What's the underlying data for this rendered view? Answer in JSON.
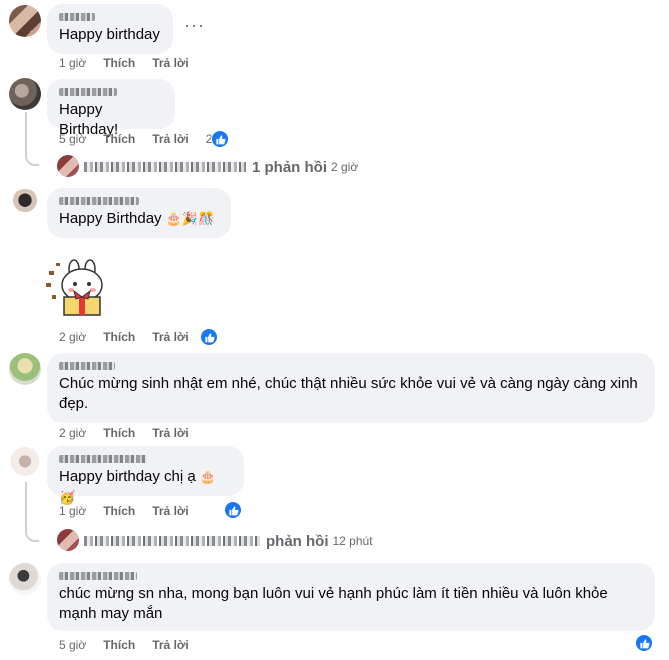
{
  "comments": [
    {
      "text": "Happy birthday",
      "time": "1 giờ",
      "like": "Thích",
      "reply": "Trả lời"
    },
    {
      "text": "Happy Birthday!",
      "time": "5 giờ",
      "like": "Thích",
      "reply": "Trả lời",
      "reactions": "2",
      "replies_summary": {
        "count": "1 phản hồi",
        "time": "2 giờ"
      }
    },
    {
      "text": "Happy Birthday",
      "time": "2 giờ",
      "like": "Thích",
      "reply": "Trả lời",
      "has_sticker": true
    },
    {
      "text_line1": "Chúc mừng sinh nhật em nhé, chúc thật nhiều sức khỏe vui vẻ và càng ngày càng xinh",
      "text_line2": "đẹp.",
      "time": "2 giờ",
      "like": "Thích",
      "reply": "Trả lời"
    },
    {
      "text": "Happy birthday chị ạ",
      "time": "1 giờ",
      "like": "Thích",
      "reply": "Trả lời",
      "replies_summary": {
        "count": "phản hồi",
        "time": "12 phút"
      }
    },
    {
      "text_line1": "chúc mừng sn nha, mong bạn luôn vui vẻ hạnh phúc làm ít tiền nhiều và luôn khỏe",
      "text_line2": "mạnh may mắn",
      "time": "5 giờ",
      "like": "Thích",
      "reply": "Trả lời"
    }
  ],
  "icons": {
    "more": "more-dots-icon",
    "like_badge": "thumbs-up-icon",
    "accent": "#1877f2"
  }
}
